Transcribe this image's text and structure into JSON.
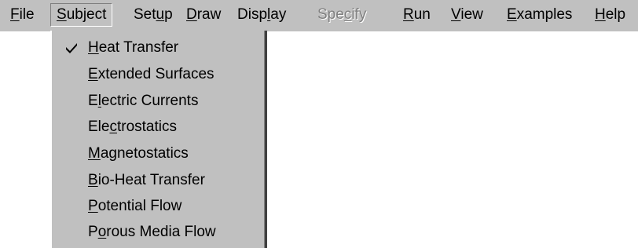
{
  "menubar": {
    "items": [
      {
        "id": "file",
        "pre": "",
        "key": "F",
        "post": "ile"
      },
      {
        "id": "subject",
        "pre": "",
        "key": "S",
        "post": "ubject"
      },
      {
        "id": "setup",
        "pre": "Set",
        "key": "u",
        "post": "p"
      },
      {
        "id": "draw",
        "pre": "",
        "key": "D",
        "post": "raw"
      },
      {
        "id": "display",
        "pre": "Disp",
        "key": "l",
        "post": "ay"
      },
      {
        "id": "specify",
        "pre": "Spe",
        "key": "c",
        "post": "ify"
      },
      {
        "id": "run",
        "pre": "",
        "key": "R",
        "post": "un"
      },
      {
        "id": "view",
        "pre": "",
        "key": "V",
        "post": "iew"
      },
      {
        "id": "examples",
        "pre": "",
        "key": "E",
        "post": "xamples"
      },
      {
        "id": "help",
        "pre": "",
        "key": "H",
        "post": "elp"
      }
    ]
  },
  "subject_menu": {
    "items": [
      {
        "pre": "",
        "key": "H",
        "post": "eat Transfer",
        "checked": true
      },
      {
        "pre": "",
        "key": "E",
        "post": "xtended Surfaces",
        "checked": false
      },
      {
        "pre": "E",
        "key": "l",
        "post": "ectric Currents",
        "checked": false
      },
      {
        "pre": "Ele",
        "key": "c",
        "post": "trostatics",
        "checked": false
      },
      {
        "pre": "",
        "key": "M",
        "post": "agnetostatics",
        "checked": false
      },
      {
        "pre": "",
        "key": "B",
        "post": "io-Heat Transfer",
        "checked": false
      },
      {
        "pre": "",
        "key": "P",
        "post": "otential Flow",
        "checked": false
      },
      {
        "pre": "P",
        "key": "o",
        "post": "rous Media Flow",
        "checked": false
      }
    ]
  }
}
